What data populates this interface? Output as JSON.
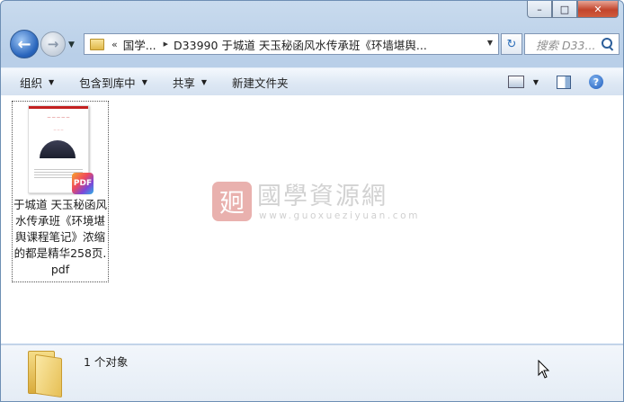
{
  "window": {
    "buttons": {
      "minimize": "–",
      "maximize": "□",
      "close": "✕"
    }
  },
  "navigation": {
    "back_glyph": "←",
    "forward_glyph": "→",
    "history_dropdown": "▼",
    "address": {
      "overflow": "«",
      "segments": [
        "国学...",
        "D33990 于城道 天玉秘函风水传承班《环墙堪舆..."
      ]
    },
    "refresh_glyph": "↻",
    "search_placeholder": "搜索 D33..."
  },
  "toolbar": {
    "organize": "组织",
    "include_in_library": "包含到库中",
    "share": "共享",
    "new_folder": "新建文件夹",
    "help": "?"
  },
  "files": [
    {
      "name": "于城道 天玉秘函风水传承班《环境堪舆课程笔记》浓缩的都是精华258页.pdf",
      "badge": "PDF",
      "type_icon": "pdf-icon"
    }
  ],
  "watermark": {
    "seal_char": "㢠",
    "brand": "國學資源網",
    "url": "www.guoxueziyuan.com"
  },
  "status": {
    "item_count": "1 个对象"
  },
  "colors": {
    "frame": "#bcd1ea",
    "close_button": "#c2452c",
    "accent": "#2a66bd"
  }
}
